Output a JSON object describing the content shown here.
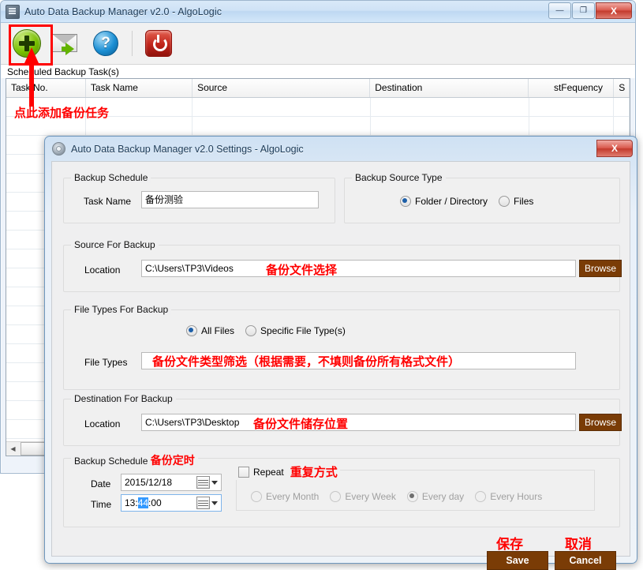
{
  "main_window": {
    "title": "Auto Data Backup Manager v2.0 - AlgoLogic",
    "icon": "app-icon",
    "window_buttons": {
      "minimize": "—",
      "maximize": "❐",
      "close": "X"
    },
    "toolbar": [
      {
        "name": "add-task",
        "icon": "plus-circle-icon"
      },
      {
        "name": "send-mail",
        "icon": "mail-forward-icon"
      },
      {
        "name": "help",
        "icon": "help-question-icon"
      },
      {
        "name": "exit",
        "icon": "power-icon"
      }
    ],
    "grid_label": "Scheduled Backup Task(s)",
    "grid_columns": [
      "Task No.",
      "Task Name",
      "Source",
      "Destination",
      "stFequency",
      "S"
    ],
    "grid_rows": [],
    "annotations": {
      "add_task": "点此添加备份任务"
    }
  },
  "dialog": {
    "title": "Auto Data Backup Manager v2.0 Settings - AlgoLogic",
    "icon": "gear-icon",
    "close_label": "X",
    "backup_schedule_top": {
      "legend": "Backup Schedule",
      "task_name_label": "Task Name",
      "task_name_value": "备份测验",
      "task_name_placeholder": ""
    },
    "backup_source_type": {
      "legend": "Backup Source Type",
      "options": [
        {
          "label": "Folder / Directory",
          "selected": true
        },
        {
          "label": "Files",
          "selected": false
        }
      ]
    },
    "source_for_backup": {
      "legend": "Source For Backup",
      "location_label": "Location",
      "location_value": "C:\\Users\\TP3\\Videos",
      "browse_label": "Browse",
      "annotation": "备份文件选择"
    },
    "file_types_for_backup": {
      "legend": "File Types For Backup",
      "options": [
        {
          "label": "All Files",
          "selected": true
        },
        {
          "label": "Specific File Type(s)",
          "selected": false
        }
      ],
      "file_types_label": "File Types",
      "file_types_value": "",
      "annotation": "备份文件类型筛选（根据需要，不填则备份所有格式文件）"
    },
    "destination_for_backup": {
      "legend": "Destination For Backup",
      "location_label": "Location",
      "location_value": "C:\\Users\\TP3\\Desktop",
      "browse_label": "Browse",
      "annotation": "备份文件储存位置"
    },
    "backup_schedule_bottom": {
      "legend": "Backup Schedule",
      "legend_annotation": "备份定时",
      "date_label": "Date",
      "date_value": "2015/12/18",
      "time_label": "Time",
      "time_value_pre": "13:",
      "time_value_sel": "44",
      "time_value_post": ":00",
      "repeat_label": "Repeat",
      "repeat_checked": false,
      "repeat_annotation": "重复方式",
      "repeat_options": [
        {
          "label": "Every Month",
          "selected": false
        },
        {
          "label": "Every Week",
          "selected": false
        },
        {
          "label": "Every day",
          "selected": true
        },
        {
          "label": "Every Hours",
          "selected": false
        }
      ]
    },
    "actions": {
      "save_label": "Save",
      "save_annotation": "保存",
      "cancel_label": "Cancel",
      "cancel_annotation": "取消"
    }
  },
  "colors": {
    "accent_brown": "#7a3c06",
    "annotation_red": "#ff0000",
    "title_blue": "#cfe2f6",
    "radio_blue": "#1d5fa8",
    "selection_blue": "#3399ff"
  }
}
